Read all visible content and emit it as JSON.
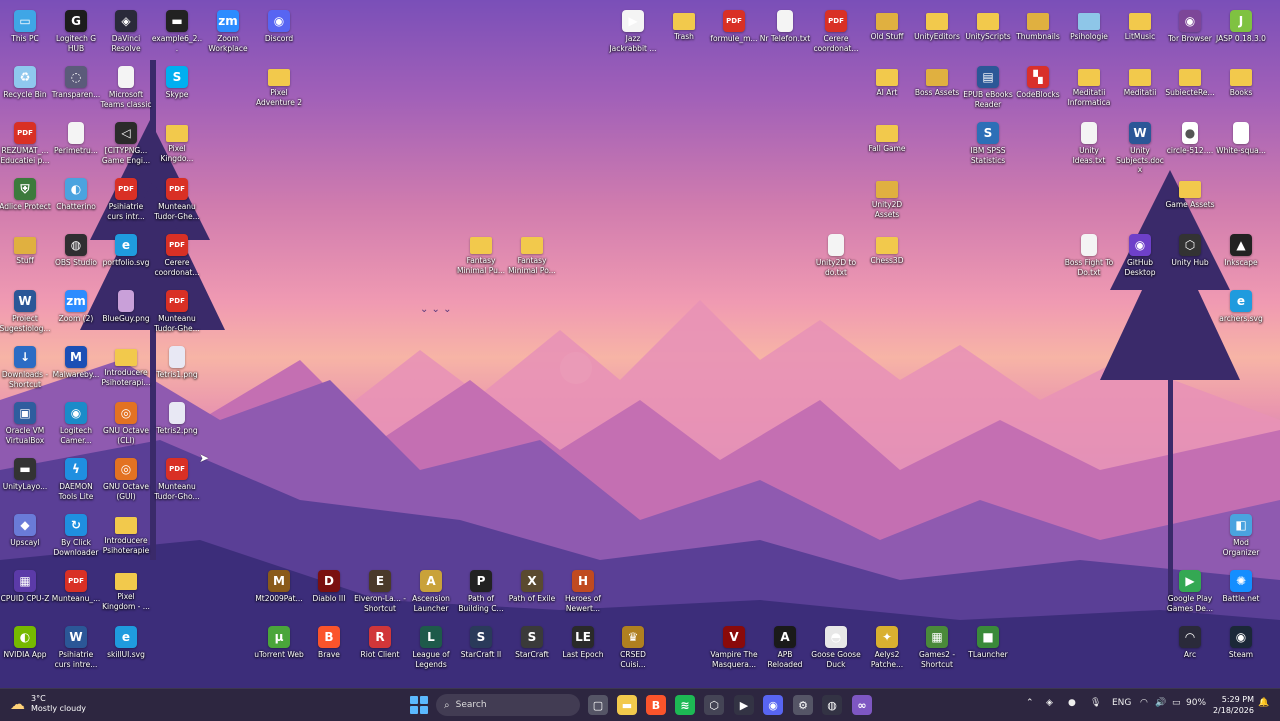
{
  "desktop": {
    "icons": [
      {
        "label": "This PC",
        "icon": "monitor-icon",
        "color": "#3fa6e6",
        "glyph": "▭",
        "kind": "app"
      },
      {
        "label": "Logitech G HUB",
        "icon": "logitech-icon",
        "color": "#1c1c1c",
        "glyph": "G",
        "kind": "app"
      },
      {
        "label": "DaVinci Resolve",
        "icon": "davinci-icon",
        "color": "#2a2a3a",
        "glyph": "◈",
        "kind": "app"
      },
      {
        "label": "example6_2...",
        "icon": "file-icon",
        "color": "#222222",
        "glyph": "▬",
        "kind": "app"
      },
      {
        "label": "Zoom Workplace",
        "icon": "zoom-icon",
        "color": "#2d8cff",
        "glyph": "zm",
        "kind": "app"
      },
      {
        "label": "Discord",
        "icon": "discord-icon",
        "color": "#5865f2",
        "glyph": "◉",
        "kind": "app"
      },
      {
        "label": "Recycle Bin",
        "icon": "recycle-bin-icon",
        "color": "#8fc8ee",
        "glyph": "♻",
        "kind": "app"
      },
      {
        "label": "Transparen...",
        "icon": "app-icon",
        "color": "#5b5b7a",
        "glyph": "◌",
        "kind": "app"
      },
      {
        "label": "Microsoft Teams classic",
        "icon": "document-icon",
        "color": "#f4f4f4",
        "glyph": "",
        "kind": "doc"
      },
      {
        "label": "Skype",
        "icon": "skype-icon",
        "color": "#00aff0",
        "glyph": "S",
        "kind": "app"
      },
      {
        "label": "Pixel Adventure 2",
        "icon": "folder-icon",
        "color": "#f2c94c",
        "glyph": "",
        "kind": "folder"
      },
      {
        "label": "REZUMAT_... Educatiei p...",
        "icon": "pdf-icon",
        "color": "#d93025",
        "glyph": "PDF",
        "kind": "app"
      },
      {
        "label": "Perimetru...",
        "icon": "image-icon",
        "color": "#f4f4f4",
        "glyph": "",
        "kind": "doc"
      },
      {
        "label": "[CITYPNG... Game Engi...",
        "icon": "unity-icon",
        "color": "#2b2b2b",
        "glyph": "◁",
        "kind": "app"
      },
      {
        "label": "Pixel Kingdo...",
        "icon": "folder-icon",
        "color": "#f2c94c",
        "glyph": "",
        "kind": "folder"
      },
      {
        "label": "Adlice Protect",
        "icon": "shield-icon",
        "color": "#3c7a3c",
        "glyph": "⛨",
        "kind": "app"
      },
      {
        "label": "Chatterino",
        "icon": "chat-icon",
        "color": "#4aa3df",
        "glyph": "◐",
        "kind": "app"
      },
      {
        "label": "Psihiatrie curs intr...",
        "icon": "pdf-icon",
        "color": "#d93025",
        "glyph": "PDF",
        "kind": "app"
      },
      {
        "label": "Munteanu Tudor-Ghe...",
        "icon": "pdf-icon",
        "color": "#d93025",
        "glyph": "PDF",
        "kind": "app"
      },
      {
        "label": "Stuff",
        "icon": "folder-icon",
        "color": "#e0b040",
        "glyph": "",
        "kind": "folder"
      },
      {
        "label": "OBS Studio",
        "icon": "obs-icon",
        "color": "#302e31",
        "glyph": "◍",
        "kind": "app"
      },
      {
        "label": "portfolio.svg",
        "icon": "edge-icon",
        "color": "#1f9bde",
        "glyph": "e",
        "kind": "app"
      },
      {
        "label": "Cerere coordonat...",
        "icon": "pdf-icon",
        "color": "#d93025",
        "glyph": "PDF",
        "kind": "app"
      },
      {
        "label": "Proiect Sugestiolog...",
        "icon": "word-icon",
        "color": "#2b5797",
        "glyph": "W",
        "kind": "app"
      },
      {
        "label": "Zoom (2)",
        "icon": "zoom-icon",
        "color": "#2d8cff",
        "glyph": "zm",
        "kind": "app"
      },
      {
        "label": "BlueGuy.png",
        "icon": "image-icon",
        "color": "#c9a0d9",
        "glyph": "",
        "kind": "doc"
      },
      {
        "label": "Munteanu Tudor-Ghe...",
        "icon": "pdf-icon",
        "color": "#d93025",
        "glyph": "PDF",
        "kind": "app"
      },
      {
        "label": "Downloads - Shortcut",
        "icon": "download-icon",
        "color": "#2b6cc4",
        "glyph": "↓",
        "kind": "app"
      },
      {
        "label": "Malwareby...",
        "icon": "malwarebytes-icon",
        "color": "#1a4fb5",
        "glyph": "M",
        "kind": "app"
      },
      {
        "label": "Introducere Psihoterapi...",
        "icon": "folder-icon",
        "color": "#f2c94c",
        "glyph": "",
        "kind": "folder"
      },
      {
        "label": "Tetris1.png",
        "icon": "image-icon",
        "color": "#e8e8f4",
        "glyph": "",
        "kind": "doc"
      },
      {
        "label": "Oracle VM VirtualBox",
        "icon": "virtualbox-icon",
        "color": "#2f5d9e",
        "glyph": "▣",
        "kind": "app"
      },
      {
        "label": "Logitech Camer...",
        "icon": "camera-icon",
        "color": "#1b8bc9",
        "glyph": "◉",
        "kind": "app"
      },
      {
        "label": "GNU Octave (CLI)",
        "icon": "octave-icon",
        "color": "#e37222",
        "glyph": "◎",
        "kind": "app"
      },
      {
        "label": "Tetris2.png",
        "icon": "image-icon",
        "color": "#e8e8f4",
        "glyph": "",
        "kind": "doc"
      },
      {
        "label": "UnityLayo...",
        "icon": "file-icon",
        "color": "#333333",
        "glyph": "▬",
        "kind": "app"
      },
      {
        "label": "DAEMON Tools Lite",
        "icon": "daemon-tools-icon",
        "color": "#1f8fe0",
        "glyph": "ϟ",
        "kind": "app"
      },
      {
        "label": "GNU Octave (GUI)",
        "icon": "octave-icon",
        "color": "#e37222",
        "glyph": "◎",
        "kind": "app"
      },
      {
        "label": "Munteanu Tudor-Gho...",
        "icon": "pdf-icon",
        "color": "#d93025",
        "glyph": "PDF",
        "kind": "app"
      },
      {
        "label": "Upscayl",
        "icon": "upscayl-icon",
        "color": "#6a7bd8",
        "glyph": "◆",
        "kind": "app"
      },
      {
        "label": "By Click Downloader",
        "icon": "download-icon",
        "color": "#1f8fe0",
        "glyph": "↻",
        "kind": "app"
      },
      {
        "label": "Introducere Psihoterapie",
        "icon": "folder-icon",
        "color": "#f2c94c",
        "glyph": "",
        "kind": "folder"
      },
      {
        "label": "CPUID CPU-Z",
        "icon": "cpu-icon",
        "color": "#5b3aa8",
        "glyph": "▦",
        "kind": "app"
      },
      {
        "label": "Munteanu_...",
        "icon": "pdf-icon",
        "color": "#d93025",
        "glyph": "PDF",
        "kind": "app"
      },
      {
        "label": "Pixel Kingdom - ...",
        "icon": "folder-icon",
        "color": "#f2c94c",
        "glyph": "",
        "kind": "folder"
      },
      {
        "label": "NVIDIA App",
        "icon": "nvidia-icon",
        "color": "#76b900",
        "glyph": "◐",
        "kind": "app"
      },
      {
        "label": "Psihiatrie curs intre...",
        "icon": "word-icon",
        "color": "#2b5797",
        "glyph": "W",
        "kind": "app"
      },
      {
        "label": "skillUI.svg",
        "icon": "edge-icon",
        "color": "#1f9bde",
        "glyph": "e",
        "kind": "app"
      },
      {
        "label": "Fantasy Minimal Pu...",
        "icon": "folder-icon",
        "color": "#f2c94c",
        "glyph": "",
        "kind": "folder"
      },
      {
        "label": "Fantasy Minimal Po...",
        "icon": "folder-icon",
        "color": "#f2c94c",
        "glyph": "",
        "kind": "folder"
      },
      {
        "label": "Jazz Jackrabbit ...",
        "icon": "play-icon",
        "color": "#f4f4f4",
        "glyph": "▶",
        "kind": "app"
      },
      {
        "label": "Trash",
        "icon": "folder-icon",
        "color": "#f2c94c",
        "glyph": "",
        "kind": "folder"
      },
      {
        "label": "formule_m...",
        "icon": "pdf-icon",
        "color": "#d93025",
        "glyph": "PDF",
        "kind": "app"
      },
      {
        "label": "Nr Telefon.txt",
        "icon": "text-file-icon",
        "color": "#f4f4f4",
        "glyph": "",
        "kind": "doc"
      },
      {
        "label": "Cerere coordonat...",
        "icon": "pdf-icon",
        "color": "#d93025",
        "glyph": "PDF",
        "kind": "app"
      },
      {
        "label": "Old Stuff",
        "icon": "folder-icon",
        "color": "#e0b040",
        "glyph": "",
        "kind": "folder"
      },
      {
        "label": "UnityEditors",
        "icon": "folder-icon",
        "color": "#f2c94c",
        "glyph": "",
        "kind": "folder"
      },
      {
        "label": "UnityScripts",
        "icon": "folder-icon",
        "color": "#f2c94c",
        "glyph": "",
        "kind": "folder"
      },
      {
        "label": "Thumbnails",
        "icon": "folder-icon",
        "color": "#e0b040",
        "glyph": "",
        "kind": "folder"
      },
      {
        "label": "Psihologie",
        "icon": "folder-icon",
        "color": "#8ec6e8",
        "glyph": "",
        "kind": "folder"
      },
      {
        "label": "LitMusic",
        "icon": "folder-icon",
        "color": "#f2c94c",
        "glyph": "",
        "kind": "folder"
      },
      {
        "label": "Tor Browser",
        "icon": "tor-icon",
        "color": "#7d4698",
        "glyph": "◉",
        "kind": "app"
      },
      {
        "label": "JASP 0.18.3.0",
        "icon": "jasp-icon",
        "color": "#7fc241",
        "glyph": "J",
        "kind": "app"
      },
      {
        "label": "AI Art",
        "icon": "folder-icon",
        "color": "#f2c94c",
        "glyph": "",
        "kind": "folder"
      },
      {
        "label": "Boss Assets",
        "icon": "folder-icon",
        "color": "#e0b040",
        "glyph": "",
        "kind": "folder"
      },
      {
        "label": "EPUB eBooks Reader",
        "icon": "ebook-icon",
        "color": "#2b5797",
        "glyph": "▤",
        "kind": "app"
      },
      {
        "label": "CodeBlocks",
        "icon": "codeblocks-icon",
        "color": "#d9302b",
        "glyph": "▚",
        "kind": "app"
      },
      {
        "label": "Meditatii Informatica",
        "icon": "folder-icon",
        "color": "#f2c94c",
        "glyph": "",
        "kind": "folder"
      },
      {
        "label": "Meditatii",
        "icon": "folder-icon",
        "color": "#f2c94c",
        "glyph": "",
        "kind": "folder"
      },
      {
        "label": "SubiecteRe...",
        "icon": "folder-icon",
        "color": "#f2c94c",
        "glyph": "",
        "kind": "folder"
      },
      {
        "label": "Books",
        "icon": "folder-icon",
        "color": "#f2c94c",
        "glyph": "",
        "kind": "folder"
      },
      {
        "label": "Fall Game",
        "icon": "folder-icon",
        "color": "#f2c94c",
        "glyph": "",
        "kind": "folder"
      },
      {
        "label": "IBM SPSS Statistics",
        "icon": "spss-icon",
        "color": "#2d6fb7",
        "glyph": "S",
        "kind": "app"
      },
      {
        "label": "Unity Ideas.txt",
        "icon": "text-file-icon",
        "color": "#f4f4f4",
        "glyph": "",
        "kind": "doc"
      },
      {
        "label": "Unity Subjects.docx",
        "icon": "word-icon",
        "color": "#2b5797",
        "glyph": "W",
        "kind": "app"
      },
      {
        "label": "circle-512....",
        "icon": "image-icon",
        "color": "#ffffff",
        "glyph": "●",
        "kind": "doc"
      },
      {
        "label": "White-squa...",
        "icon": "image-icon",
        "color": "#ffffff",
        "glyph": "",
        "kind": "doc"
      },
      {
        "label": "Unity2D Assets",
        "icon": "folder-icon",
        "color": "#e0b040",
        "glyph": "",
        "kind": "folder"
      },
      {
        "label": "Game Assets",
        "icon": "folder-icon",
        "color": "#f2c94c",
        "glyph": "",
        "kind": "folder"
      },
      {
        "label": "Unity2D to do.txt",
        "icon": "text-file-icon",
        "color": "#f4f4f4",
        "glyph": "",
        "kind": "doc"
      },
      {
        "label": "Chess3D",
        "icon": "folder-icon",
        "color": "#f2c94c",
        "glyph": "",
        "kind": "folder"
      },
      {
        "label": "Boss Fight To Do.txt",
        "icon": "text-file-icon",
        "color": "#f4f4f4",
        "glyph": "",
        "kind": "doc"
      },
      {
        "label": "GitHub Desktop",
        "icon": "github-icon",
        "color": "#6e40c9",
        "glyph": "◉",
        "kind": "app"
      },
      {
        "label": "Unity Hub",
        "icon": "unity-hub-icon",
        "color": "#333333",
        "glyph": "⬡",
        "kind": "app"
      },
      {
        "label": "Inkscape",
        "icon": "inkscape-icon",
        "color": "#222222",
        "glyph": "▲",
        "kind": "app"
      },
      {
        "label": "archers.svg",
        "icon": "edge-icon",
        "color": "#1f9bde",
        "glyph": "e",
        "kind": "app"
      },
      {
        "label": "Mt2009Pat...",
        "icon": "game-icon",
        "color": "#8a5a1a",
        "glyph": "M",
        "kind": "app"
      },
      {
        "label": "Diablo III",
        "icon": "diablo-icon",
        "color": "#7a1010",
        "glyph": "D",
        "kind": "app"
      },
      {
        "label": "Elveron-La... - Shortcut",
        "icon": "game-icon",
        "color": "#4a3a2a",
        "glyph": "E",
        "kind": "app"
      },
      {
        "label": "Ascension Launcher",
        "icon": "game-icon",
        "color": "#c9a23a",
        "glyph": "A",
        "kind": "app"
      },
      {
        "label": "Path of Building C...",
        "icon": "game-icon",
        "color": "#222222",
        "glyph": "P",
        "kind": "app"
      },
      {
        "label": "Path of Exile",
        "icon": "game-icon",
        "color": "#5a4a30",
        "glyph": "X",
        "kind": "app"
      },
      {
        "label": "Heroes of Newert...",
        "icon": "game-icon",
        "color": "#c04a20",
        "glyph": "H",
        "kind": "app"
      },
      {
        "label": "uTorrent Web",
        "icon": "utorrent-icon",
        "color": "#4aa63a",
        "glyph": "µ",
        "kind": "app"
      },
      {
        "label": "Brave",
        "icon": "brave-icon",
        "color": "#fb542b",
        "glyph": "B",
        "kind": "app"
      },
      {
        "label": "Riot Client",
        "icon": "riot-icon",
        "color": "#d13639",
        "glyph": "R",
        "kind": "app"
      },
      {
        "label": "League of Legends",
        "icon": "lol-icon",
        "color": "#1e5a4a",
        "glyph": "L",
        "kind": "app"
      },
      {
        "label": "StarCraft II",
        "icon": "starcraft-icon",
        "color": "#2a3a5a",
        "glyph": "S",
        "kind": "app"
      },
      {
        "label": "StarCraft",
        "icon": "starcraft-icon",
        "color": "#3a3a3a",
        "glyph": "S",
        "kind": "app"
      },
      {
        "label": "Last Epoch",
        "icon": "game-icon",
        "color": "#2a2a2a",
        "glyph": "LE",
        "kind": "app"
      },
      {
        "label": "CRSED Cuisi...",
        "icon": "game-icon",
        "color": "#b08020",
        "glyph": "♛",
        "kind": "app"
      },
      {
        "label": "Vampire The Masquera...",
        "icon": "game-icon",
        "color": "#8a0a0a",
        "glyph": "V",
        "kind": "app"
      },
      {
        "label": "APB Reloaded",
        "icon": "game-icon",
        "color": "#1a1a1a",
        "glyph": "A",
        "kind": "app"
      },
      {
        "label": "Goose Goose Duck",
        "icon": "game-icon",
        "color": "#e8e8e8",
        "glyph": "◓",
        "kind": "app"
      },
      {
        "label": "Aelys2 Patche...",
        "icon": "game-icon",
        "color": "#d9b030",
        "glyph": "✦",
        "kind": "app"
      },
      {
        "label": "Games2 - Shortcut",
        "icon": "game-icon",
        "color": "#4a8a3a",
        "glyph": "▦",
        "kind": "app"
      },
      {
        "label": "TLauncher",
        "icon": "minecraft-icon",
        "color": "#3a8a3a",
        "glyph": "■",
        "kind": "app"
      },
      {
        "label": "Mod Organizer",
        "icon": "app-icon",
        "color": "#4aa3df",
        "glyph": "◧",
        "kind": "app"
      },
      {
        "label": "Google Play Games De...",
        "icon": "google-play-icon",
        "color": "#34a853",
        "glyph": "▶",
        "kind": "app"
      },
      {
        "label": "Battle.net",
        "icon": "battlenet-icon",
        "color": "#148eff",
        "glyph": "✺",
        "kind": "app"
      },
      {
        "label": "Arc",
        "icon": "arc-icon",
        "color": "#2a2a3a",
        "glyph": "◠",
        "kind": "app"
      },
      {
        "label": "Steam",
        "icon": "steam-icon",
        "color": "#1b2838",
        "glyph": "◉",
        "kind": "app"
      }
    ]
  },
  "taskbar": {
    "weather": {
      "temp": "3°C",
      "condition": "Mostly cloudy"
    },
    "search": {
      "placeholder": "Search"
    },
    "pinned_apps": [
      {
        "name": "task-view-icon",
        "glyph": "▢",
        "color": "#555566"
      },
      {
        "name": "file-explorer-icon",
        "glyph": "▬",
        "color": "#f2c94c"
      },
      {
        "name": "brave-icon",
        "glyph": "B",
        "color": "#fb542b"
      },
      {
        "name": "spotify-icon",
        "glyph": "≋",
        "color": "#1db954"
      },
      {
        "name": "unity-hub-icon",
        "glyph": "⬡",
        "color": "#444455"
      },
      {
        "name": "media-player-icon",
        "glyph": "▶",
        "color": "#333344"
      },
      {
        "name": "discord-icon",
        "glyph": "◉",
        "color": "#5865f2"
      },
      {
        "name": "settings-icon",
        "glyph": "⚙",
        "color": "#555566"
      },
      {
        "name": "obs-icon",
        "glyph": "◍",
        "color": "#333344"
      },
      {
        "name": "visual-studio-icon",
        "glyph": "∞",
        "color": "#7e57c2"
      }
    ],
    "tray": {
      "language": "ENG",
      "battery": "90%",
      "time": "5:29 PM",
      "date": "2/18/2026"
    }
  }
}
